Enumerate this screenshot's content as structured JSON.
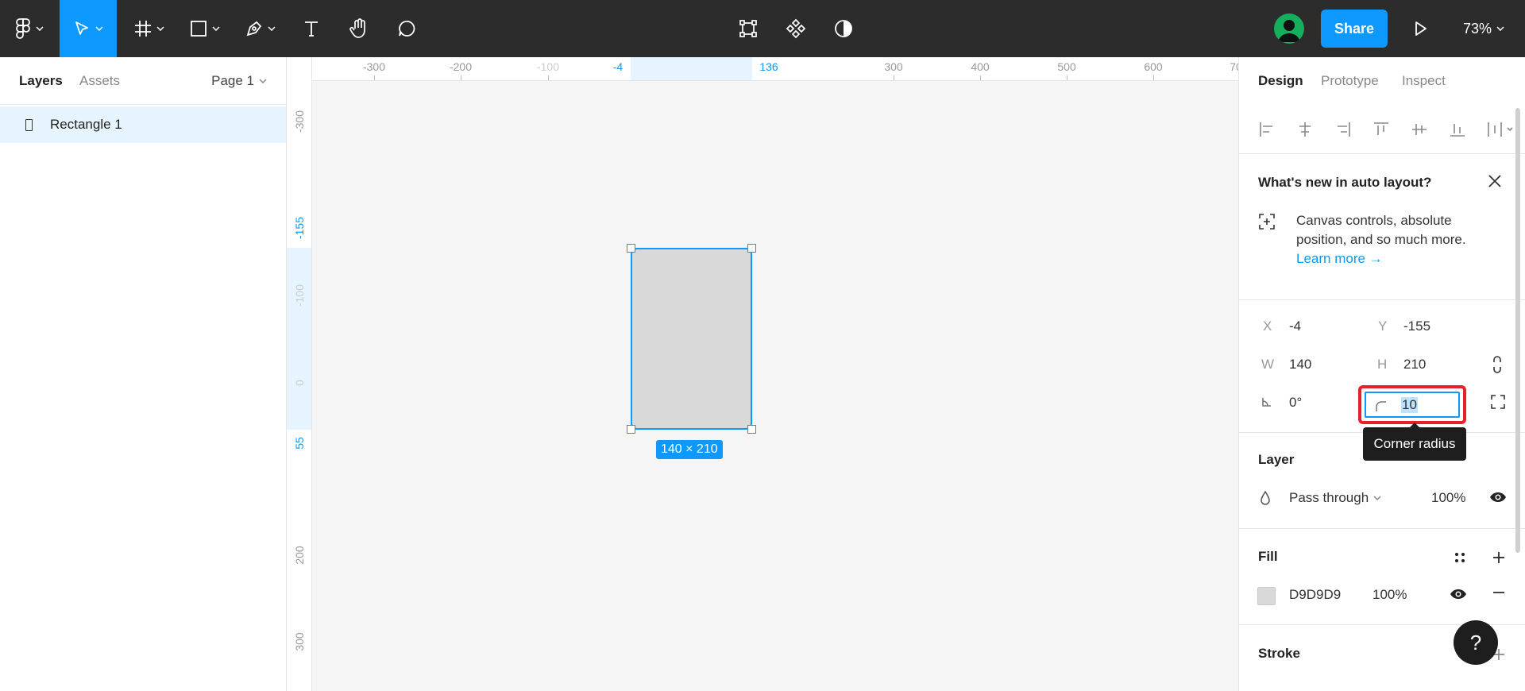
{
  "toolbar": {
    "share_label": "Share",
    "zoom": "73%"
  },
  "left_panel": {
    "tabs": [
      "Layers",
      "Assets"
    ],
    "page_label": "Page 1",
    "layers": [
      {
        "name": "Rectangle 1"
      }
    ]
  },
  "rulers": {
    "top_labels": [
      "-300",
      "-200",
      "-100",
      "-4",
      "136",
      "300",
      "400",
      "500",
      "600",
      "70"
    ],
    "left_labels": [
      "-300",
      "-155",
      "-100",
      "0",
      "55",
      "200",
      "300"
    ]
  },
  "canvas": {
    "dimension_badge": "140 × 210"
  },
  "right_panel": {
    "tabs": [
      "Design",
      "Prototype",
      "Inspect"
    ],
    "whats_new": {
      "title": "What's new in auto layout?",
      "body": "Canvas controls, absolute position, and so much more.",
      "link": "Learn more →"
    },
    "props": {
      "x_label": "X",
      "x_value": "-4",
      "y_label": "Y",
      "y_value": "-155",
      "w_label": "W",
      "w_value": "140",
      "h_label": "H",
      "h_value": "210",
      "rotation_value": "0°",
      "radius_value": "10",
      "radius_tooltip": "Corner radius"
    },
    "layer_section": {
      "title": "Layer",
      "blend_mode": "Pass through",
      "opacity": "100%"
    },
    "fill_section": {
      "title": "Fill",
      "hex": "D9D9D9",
      "opacity": "100%",
      "color": "#d9d9d9"
    },
    "stroke_section": {
      "title": "Stroke"
    }
  },
  "help_label": "?",
  "colors": {
    "accent": "#0d99ff",
    "toolbar_bg": "#2c2c2c",
    "highlight": "#e8202a"
  }
}
